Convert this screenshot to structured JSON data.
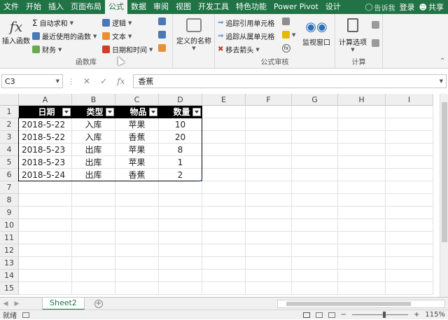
{
  "tabs": [
    "文件",
    "开始",
    "插入",
    "页面布局",
    "公式",
    "数据",
    "审阅",
    "视图",
    "开发工具",
    "特色功能",
    "Power Pivot",
    "设计"
  ],
  "active_tab": "公式",
  "tell_me": "告诉我",
  "login": "登录",
  "share": "共享",
  "ribbon": {
    "insert_function": "插入函数",
    "autosum": "自动求和",
    "recent": "最近使用的函数",
    "financial": "财务",
    "logical": "逻辑",
    "text": "文本",
    "datetime": "日期和时间",
    "group_library": "函数库",
    "defined_names": "定义的名称",
    "trace_precedents": "追踪引用单元格",
    "trace_dependents": "追踪从属单元格",
    "remove_arrows": "移去箭头",
    "watch_window": "监视窗口",
    "group_audit": "公式审核",
    "calc_options": "计算选项",
    "group_calc": "计算"
  },
  "formula_bar": {
    "name_box": "C3",
    "formula": "香蕉"
  },
  "columns": [
    "A",
    "B",
    "C",
    "D",
    "E",
    "F",
    "G",
    "H",
    "I"
  ],
  "rows": [
    "1",
    "2",
    "3",
    "4",
    "5",
    "6",
    "7",
    "8",
    "9",
    "10",
    "11",
    "12",
    "13",
    "14",
    "15"
  ],
  "table": {
    "headers": [
      "日期",
      "类型",
      "物品",
      "数量"
    ],
    "data": [
      [
        "2018-5-22",
        "入库",
        "苹果",
        "10"
      ],
      [
        "2018-5-22",
        "入库",
        "香蕉",
        "20"
      ],
      [
        "2018-5-23",
        "出库",
        "苹果",
        "8"
      ],
      [
        "2018-5-23",
        "出库",
        "苹果",
        "1"
      ],
      [
        "2018-5-24",
        "出库",
        "香蕉",
        "2"
      ]
    ]
  },
  "sheet_tab": "Sheet2",
  "status": {
    "ready": "就绪",
    "zoom": "115%"
  }
}
